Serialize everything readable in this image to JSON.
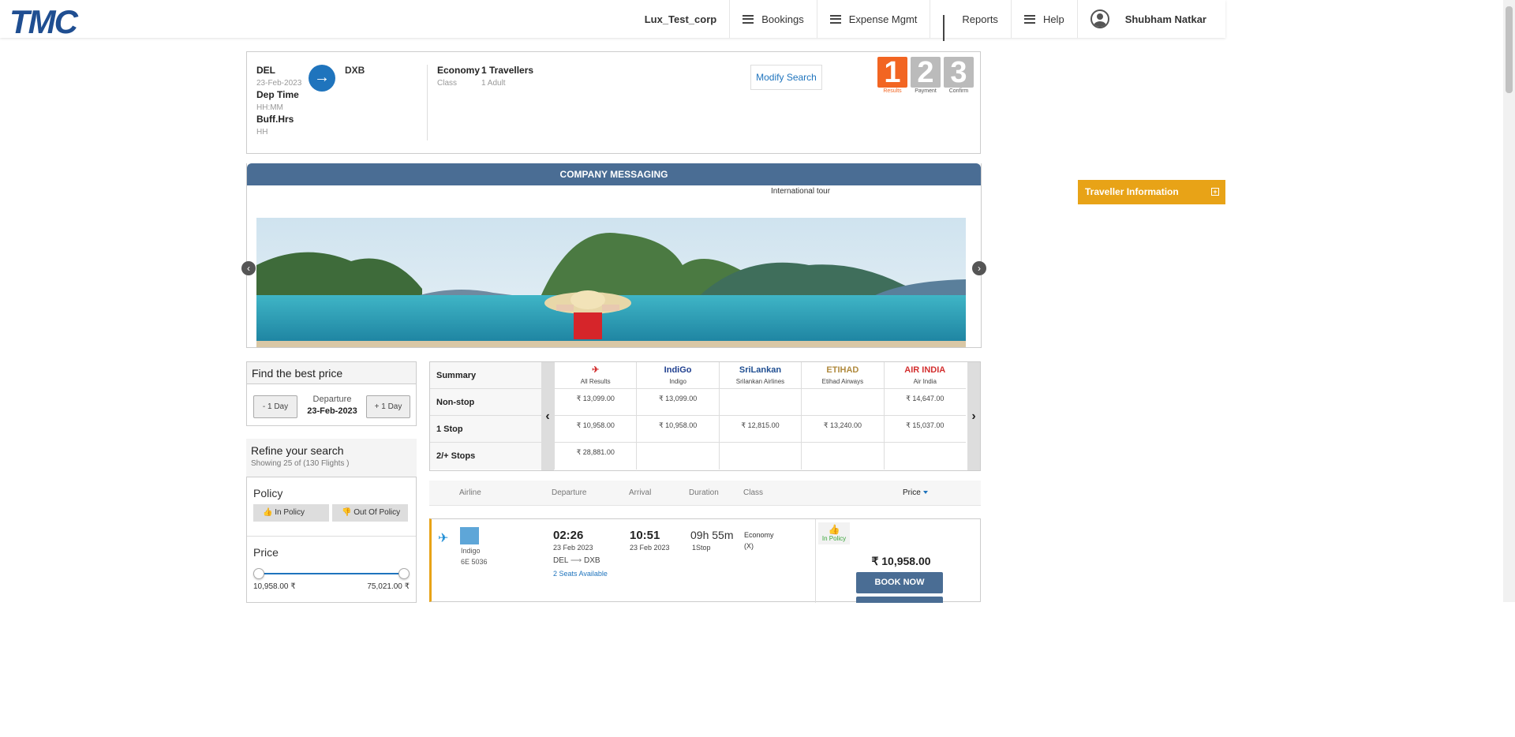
{
  "header": {
    "logo": "TMC",
    "company": "Lux_Test_corp",
    "nav": [
      "Bookings",
      "Expense Mgmt",
      "Reports",
      "Help"
    ],
    "user": "Shubham Natkar"
  },
  "search": {
    "from": "DEL",
    "date": "23-Feb-2023",
    "dep_time_label": "Dep Time",
    "dep_time_placeholder": "HH:MM",
    "buff_label": "Buff.Hrs",
    "buff_placeholder": "HH",
    "to": "DXB",
    "class_value": "Economy",
    "class_label": "Class",
    "travellers_value": "1 Travellers",
    "travellers_sub": "1 Adult",
    "modify_label": "Modify Search",
    "steps": [
      {
        "num": "1",
        "label": "Results"
      },
      {
        "num": "2",
        "label": "Payment"
      },
      {
        "num": "3",
        "label": "Confirm"
      }
    ]
  },
  "messaging": {
    "title": "COMPANY MESSAGING",
    "caption": "International tour"
  },
  "traveller_info": "Traveller Information",
  "best_price": {
    "title": "Find the best price",
    "minus": "- 1 Day",
    "plus": "+ 1 Day",
    "dep_label": "Departure",
    "dep_date": "23-Feb-2023"
  },
  "refine": {
    "title": "Refine your search",
    "showing": "Showing 25 of (130 Flights )",
    "policy_title": "Policy",
    "in_policy": "In Policy",
    "out_policy": "Out Of Policy",
    "price_title": "Price",
    "price_min": "10,958.00 ₹",
    "price_max": "75,021.00 ₹"
  },
  "matrix": {
    "row_labels": [
      "Summary",
      "Non-stop",
      "1 Stop",
      "2/+ Stops"
    ],
    "airlines": [
      {
        "logo": "✈",
        "name": "All Results",
        "prices": [
          "₹ 13,099.00",
          "₹ 10,958.00",
          "₹ 28,881.00"
        ],
        "color": "#d32f2f"
      },
      {
        "logo": "IndiGo",
        "name": "Indigo",
        "prices": [
          "₹ 13,099.00",
          "₹ 10,958.00",
          ""
        ],
        "color": "#1f3f8f"
      },
      {
        "logo": "SriLankan",
        "name": "Srilankan Airlines",
        "prices": [
          "",
          "₹ 12,815.00",
          ""
        ],
        "color": "#1f4e91"
      },
      {
        "logo": "ETIHAD",
        "name": "Etihad Airways",
        "prices": [
          "",
          "₹ 13,240.00",
          ""
        ],
        "color": "#b08a3e"
      },
      {
        "logo": "AIR INDIA",
        "name": "Air India",
        "prices": [
          "₹ 14,647.00",
          "₹ 15,037.00",
          ""
        ],
        "color": "#d32f2f"
      }
    ]
  },
  "sort": {
    "airline": "Airline",
    "departure": "Departure",
    "arrival": "Arrival",
    "duration": "Duration",
    "class": "Class",
    "price": "Price"
  },
  "flight": {
    "airline": "Indigo",
    "number": "6E  5036",
    "dep_time": "02:26",
    "dep_date": "23 Feb 2023",
    "route_from": "DEL",
    "route_to": "DXB",
    "seats": "2 Seats Available",
    "arr_time": "10:51",
    "arr_date": "23 Feb 2023",
    "duration": "09h 55m",
    "stops": "1Stop",
    "class": "Economy",
    "class_code": "(X)",
    "policy": "In Policy",
    "price": "₹ 10,958.00",
    "book": "BOOK NOW"
  }
}
